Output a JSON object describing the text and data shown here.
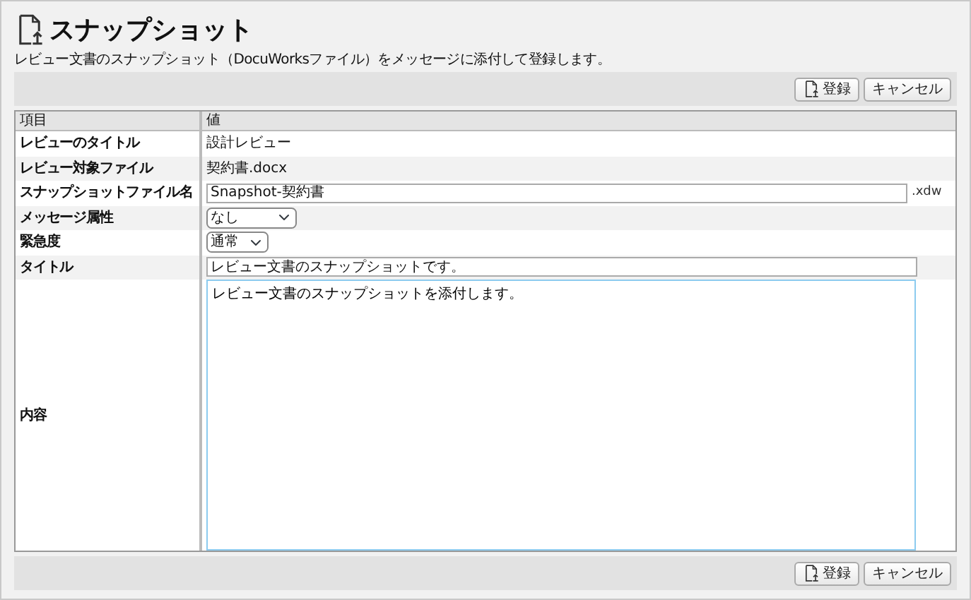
{
  "page": {
    "title": "スナップショット",
    "description": "レビュー文書のスナップショット（DocuWorksファイル）をメッセージに添付して登録します。"
  },
  "toolbar_top": {
    "buttons": [
      {
        "label": "登録",
        "kind": "submit"
      },
      {
        "label": "キャンセル",
        "kind": "cancel"
      }
    ]
  },
  "table": {
    "columns": [
      "項目",
      "値"
    ],
    "rows": [
      {
        "label": "レビューのタイトル",
        "kind": "text",
        "value": "設計レビュー"
      },
      {
        "label": "レビュー対象ファイル",
        "kind": "text",
        "value": "契約書.docx"
      },
      {
        "label": "スナップショットファイル名",
        "kind": "input",
        "value": "Snapshot-契約書",
        "suffix": ".xdw"
      },
      {
        "label": "メッセージ属性",
        "kind": "select",
        "value": "なし"
      },
      {
        "label": "緊急度",
        "kind": "select",
        "value": "通常"
      },
      {
        "label": "タイトル",
        "kind": "input",
        "value": "レビュー文書のスナップショットです。"
      },
      {
        "label": "内容",
        "kind": "textarea",
        "value": "レビュー文書のスナップショットを添付します。"
      }
    ]
  },
  "toolbar_bottom": {
    "buttons": [
      {
        "label": "登録",
        "kind": "submit"
      },
      {
        "label": "キャンセル",
        "kind": "cancel"
      }
    ]
  }
}
